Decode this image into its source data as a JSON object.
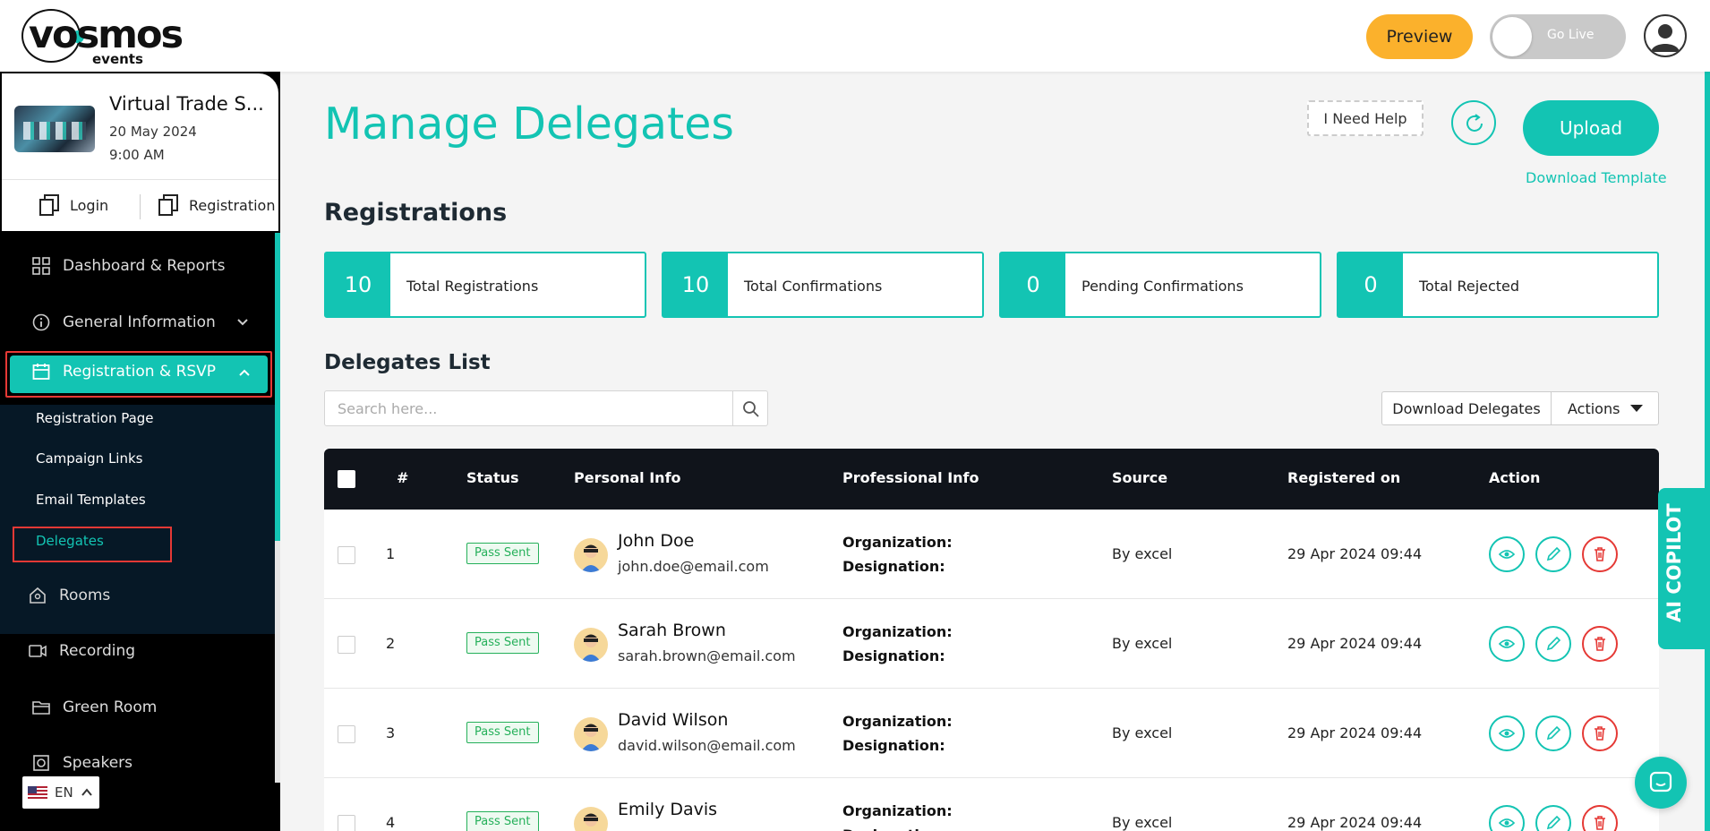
{
  "brand": {
    "logo_text": "vosmos",
    "logo_sub": "events"
  },
  "topbar": {
    "preview_label": "Preview",
    "go_live_label": "Go Live"
  },
  "event": {
    "title": "Virtual Trade S...",
    "date": "20 May 2024",
    "time": "9:00 AM",
    "login_label": "Login",
    "registration_label": "Registration"
  },
  "sidebar": {
    "items": [
      {
        "label": "Dashboard & Reports",
        "icon": "grid-icon"
      },
      {
        "label": "General Information",
        "icon": "info-icon"
      },
      {
        "label": "Registration & RSVP",
        "icon": "calendar-icon"
      },
      {
        "label": "Rooms",
        "icon": "home-icon"
      },
      {
        "label": "Recording",
        "icon": "video-icon"
      },
      {
        "label": "Green Room",
        "icon": "folder-icon"
      },
      {
        "label": "Speakers",
        "icon": "speaker-icon"
      }
    ],
    "subitems": [
      "Registration Page",
      "Campaign Links",
      "Email Templates",
      "Delegates"
    ],
    "language": "EN"
  },
  "main": {
    "title": "Manage Delegates",
    "help_label": "I Need Help",
    "upload_label": "Upload",
    "download_template_label": "Download Template",
    "registrations_title": "Registrations",
    "stats": [
      {
        "value": "10",
        "label": "Total Registrations"
      },
      {
        "value": "10",
        "label": "Total Confirmations"
      },
      {
        "value": "0",
        "label": "Pending Confirmations"
      },
      {
        "value": "0",
        "label": "Total Rejected"
      }
    ],
    "list_title": "Delegates List",
    "search_placeholder": "Search here...",
    "download_delegates_label": "Download Delegates",
    "actions_label": "Actions",
    "columns": [
      "#",
      "Status",
      "Personal Info",
      "Professional Info",
      "Source",
      "Registered on",
      "Action"
    ],
    "org_label": "Organization:",
    "des_label": "Designation:",
    "rows": [
      {
        "num": "1",
        "status": "Pass Sent",
        "name": "John Doe",
        "email": "john.doe@email.com",
        "source": "By excel",
        "registered": "29 Apr 2024 09:44"
      },
      {
        "num": "2",
        "status": "Pass Sent",
        "name": "Sarah Brown",
        "email": "sarah.brown@email.com",
        "source": "By excel",
        "registered": "29 Apr 2024 09:44"
      },
      {
        "num": "3",
        "status": "Pass Sent",
        "name": "David Wilson",
        "email": "david.wilson@email.com",
        "source": "By excel",
        "registered": "29 Apr 2024 09:44"
      },
      {
        "num": "4",
        "status": "Pass Sent",
        "name": "Emily Davis",
        "email": "",
        "source": "By excel",
        "registered": "29 Apr 2024 09:44"
      }
    ]
  },
  "copilot_label": "AI COPILOT",
  "colors": {
    "accent": "#13c4b3",
    "preview": "#fbb12c",
    "danger": "#e53935",
    "success": "#25b05a"
  }
}
